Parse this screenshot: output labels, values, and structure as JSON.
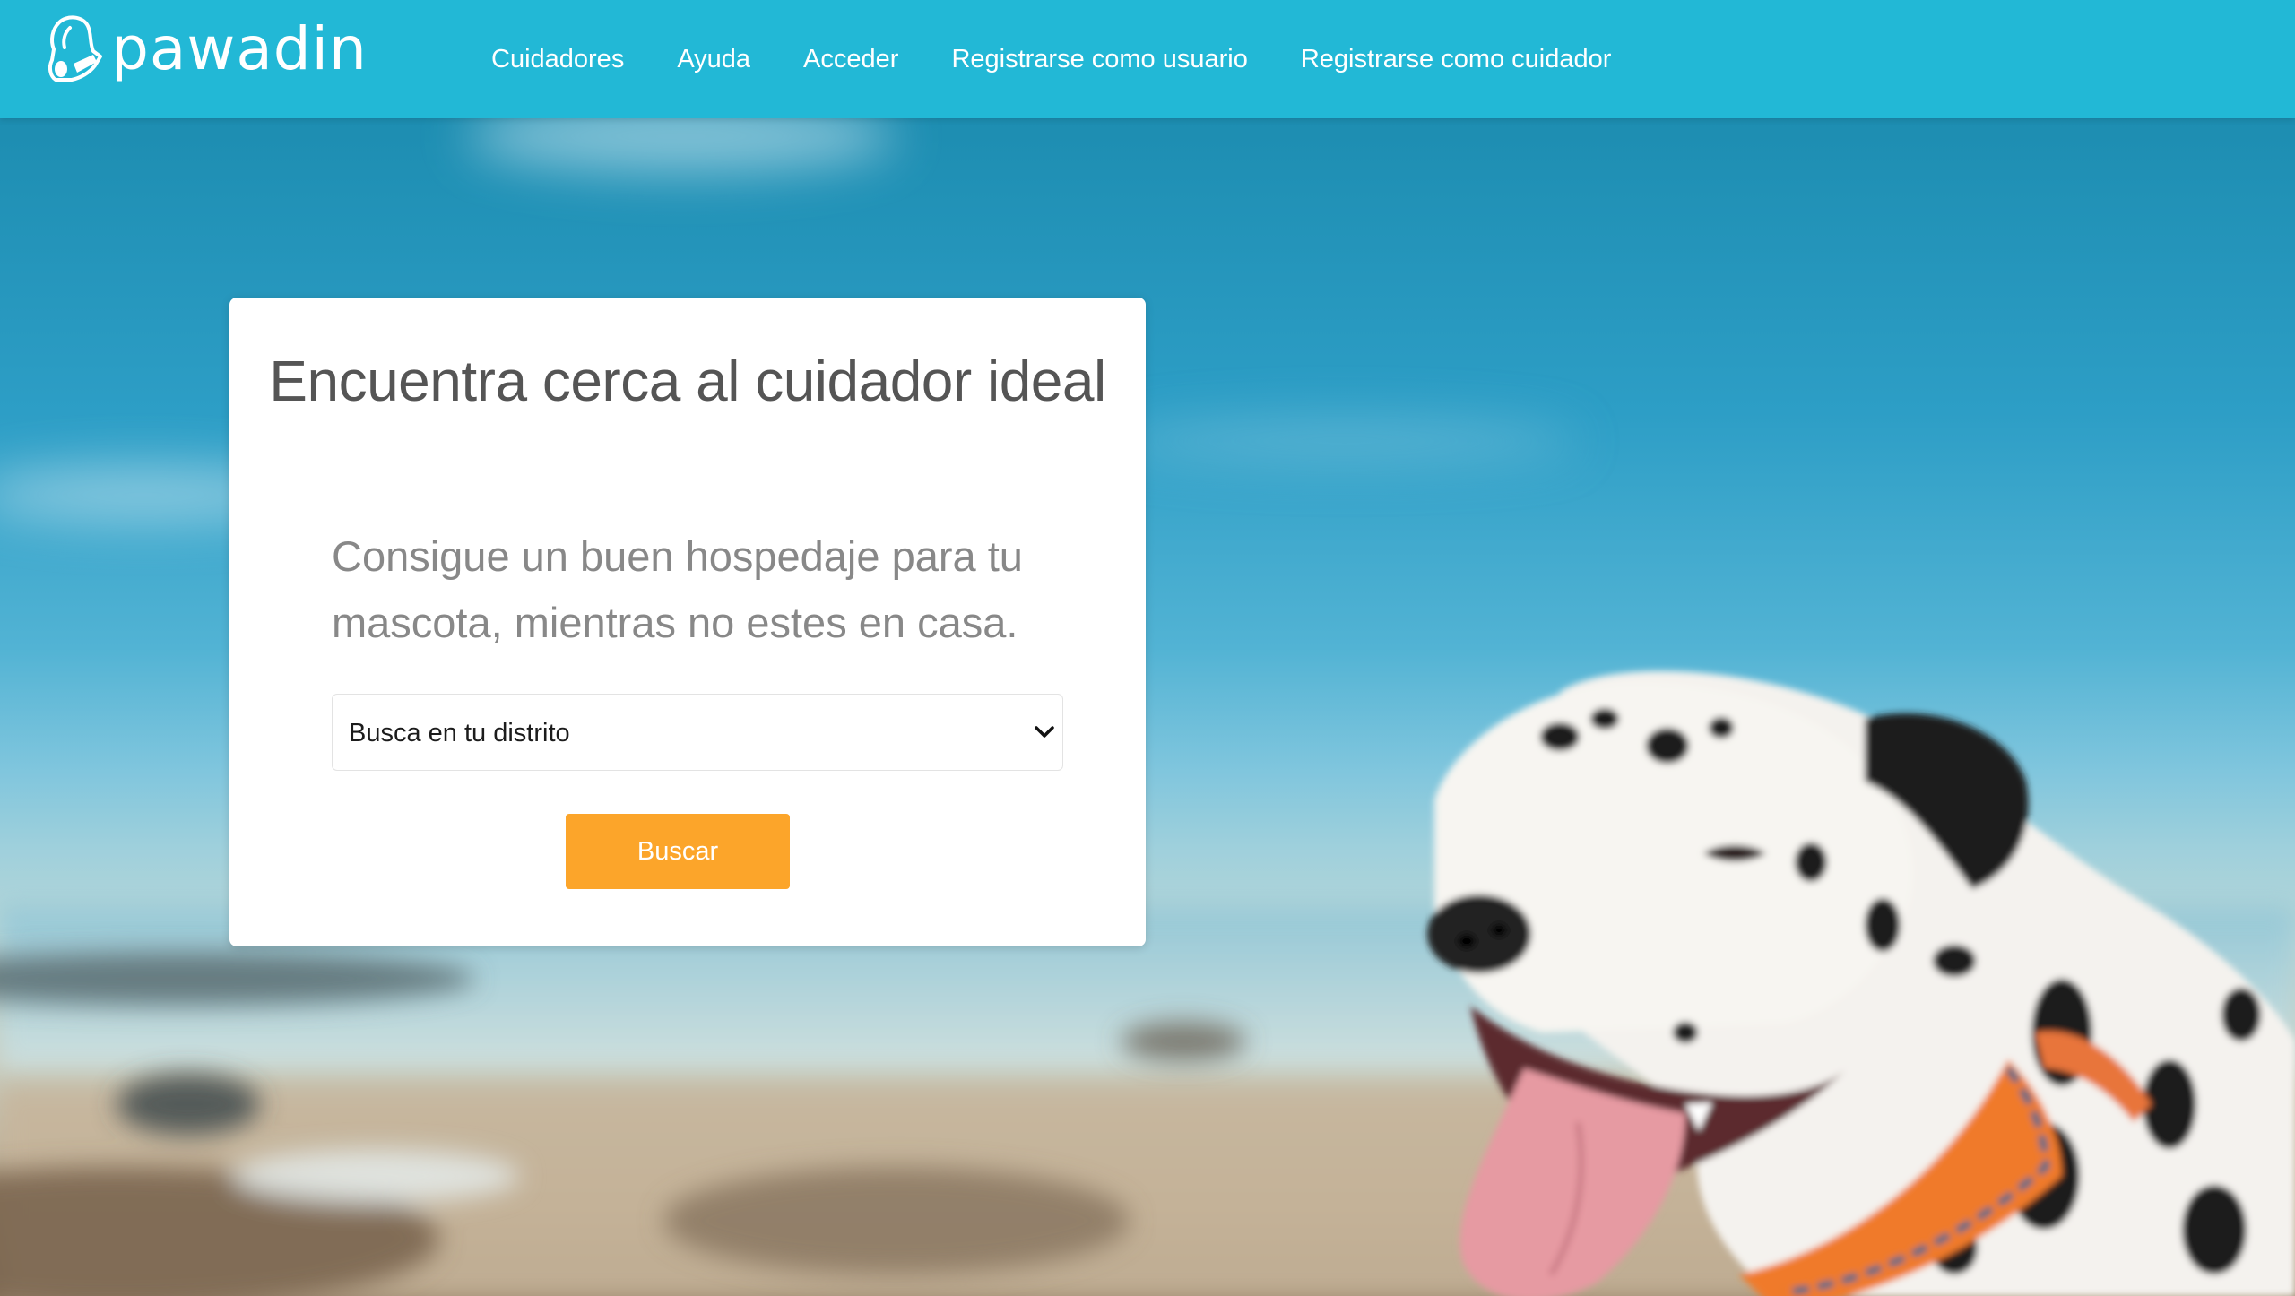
{
  "brand": {
    "name": "pawadin"
  },
  "nav": {
    "items": [
      {
        "label": "Cuidadores"
      },
      {
        "label": "Ayuda"
      },
      {
        "label": "Acceder"
      },
      {
        "label": "Registrarse como usuario"
      },
      {
        "label": "Registrarse como cuidador"
      }
    ]
  },
  "search_card": {
    "title": "Encuentra cerca al cuidador ideal",
    "subtitle": "Consigue un buen hospedaje para tu mascota, mientras no estes en casa.",
    "district_select": {
      "selected": "Busca en tu distrito"
    },
    "button_label": "Buscar"
  },
  "hero": {
    "image": "dalmatian-dog-on-beach"
  },
  "colors": {
    "navbar": "#22b8d6",
    "button": "#fca52a",
    "title_text": "#555555",
    "subtitle_text": "#888888"
  }
}
